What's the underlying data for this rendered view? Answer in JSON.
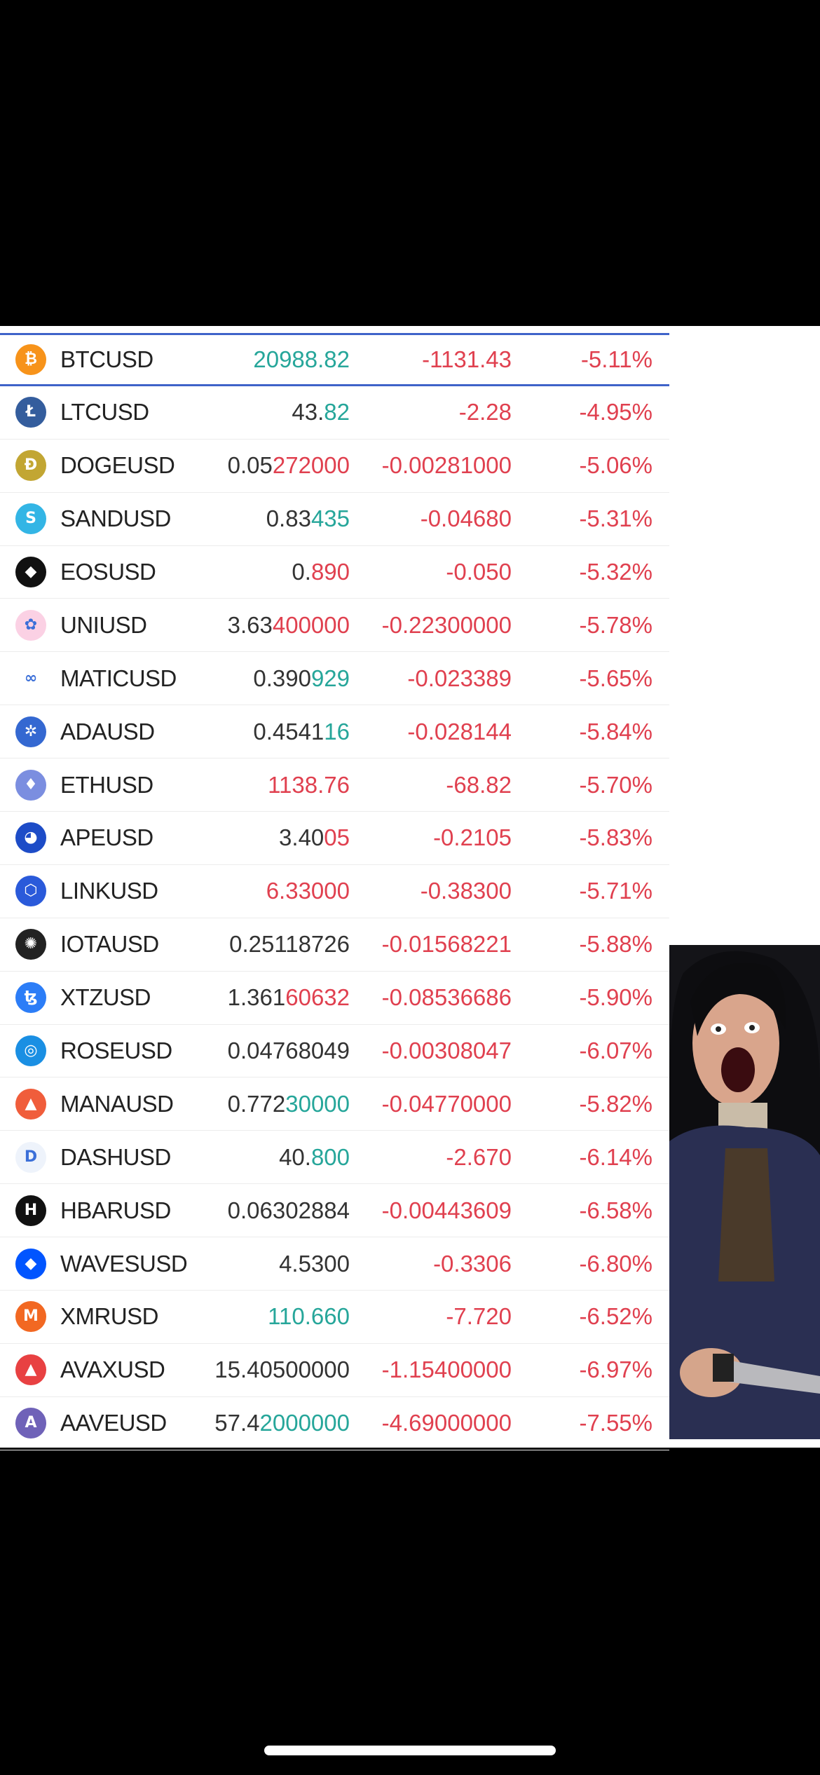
{
  "rows": [
    {
      "symbol": "BTCUSD",
      "icon": "bitcoin-icon",
      "icon_color": "#f7931a",
      "glyph": "₿",
      "last": [
        {
          "t": "20988.82",
          "c": "g"
        }
      ],
      "change": "-1131.43",
      "pct": "-5.11%",
      "selected": true
    },
    {
      "symbol": "LTCUSD",
      "icon": "litecoin-icon",
      "icon_color": "#345d9d",
      "glyph": "Ł",
      "last": [
        {
          "t": "43.",
          "c": ""
        },
        {
          "t": "82",
          "c": "g"
        }
      ],
      "change": "-2.28",
      "pct": "-4.95%"
    },
    {
      "symbol": "DOGEUSD",
      "icon": "dogecoin-icon",
      "icon_color": "#c2a633",
      "glyph": "Ð",
      "last": [
        {
          "t": "0.05",
          "c": ""
        },
        {
          "t": "272000",
          "c": "r"
        }
      ],
      "change": "-0.00281000",
      "pct": "-5.06%"
    },
    {
      "symbol": "SANDUSD",
      "icon": "sandbox-icon",
      "icon_color": "#33b5e5",
      "glyph": "S",
      "last": [
        {
          "t": "0.83",
          "c": ""
        },
        {
          "t": "435",
          "c": "g"
        }
      ],
      "change": "-0.04680",
      "pct": "-5.31%"
    },
    {
      "symbol": "EOSUSD",
      "icon": "eos-icon",
      "icon_color": "#111111",
      "glyph": "◆",
      "last": [
        {
          "t": "0.",
          "c": ""
        },
        {
          "t": "890",
          "c": "r"
        }
      ],
      "change": "-0.050",
      "pct": "-5.32%"
    },
    {
      "symbol": "UNIUSD",
      "icon": "uniswap-icon",
      "icon_color": "#fbd1e4",
      "glyph": "✿",
      "last": [
        {
          "t": "3.63",
          "c": ""
        },
        {
          "t": "400000",
          "c": "r"
        }
      ],
      "change": "-0.22300000",
      "pct": "-5.78%"
    },
    {
      "symbol": "MATICUSD",
      "icon": "polygon-icon",
      "icon_color": "#ffffff",
      "glyph": "∞",
      "last": [
        {
          "t": "0.390",
          "c": ""
        },
        {
          "t": "929",
          "c": "g"
        }
      ],
      "change": "-0.023389",
      "pct": "-5.65%"
    },
    {
      "symbol": "ADAUSD",
      "icon": "cardano-icon",
      "icon_color": "#3468d1",
      "glyph": "✲",
      "last": [
        {
          "t": "0.4541",
          "c": ""
        },
        {
          "t": "16",
          "c": "g"
        }
      ],
      "change": "-0.028144",
      "pct": "-5.84%"
    },
    {
      "symbol": "ETHUSD",
      "icon": "ethereum-icon",
      "icon_color": "#7b8ee0",
      "glyph": "♦",
      "last": [
        {
          "t": "1138.76",
          "c": "r"
        }
      ],
      "change": "-68.82",
      "pct": "-5.70%"
    },
    {
      "symbol": "APEUSD",
      "icon": "apecoin-icon",
      "icon_color": "#1d4cc7",
      "glyph": "◕",
      "last": [
        {
          "t": "3.40",
          "c": ""
        },
        {
          "t": "05",
          "c": "r"
        }
      ],
      "change": "-0.2105",
      "pct": "-5.83%"
    },
    {
      "symbol": "LINKUSD",
      "icon": "chainlink-icon",
      "icon_color": "#2a5ada",
      "glyph": "⬡",
      "last": [
        {
          "t": "6.33000",
          "c": "r"
        }
      ],
      "change": "-0.38300",
      "pct": "-5.71%"
    },
    {
      "symbol": "IOTAUSD",
      "icon": "iota-icon",
      "icon_color": "#222222",
      "glyph": "✺",
      "last": [
        {
          "t": "0.25118726",
          "c": ""
        }
      ],
      "change": "-0.01568221",
      "pct": "-5.88%"
    },
    {
      "symbol": "XTZUSD",
      "icon": "tezos-icon",
      "icon_color": "#2c7df7",
      "glyph": "ꜩ",
      "last": [
        {
          "t": "1.361",
          "c": ""
        },
        {
          "t": "60632",
          "c": "r"
        }
      ],
      "change": "-0.08536686",
      "pct": "-5.90%"
    },
    {
      "symbol": "ROSEUSD",
      "icon": "oasis-icon",
      "icon_color": "#1a8fe3",
      "glyph": "◎",
      "last": [
        {
          "t": "0.04768049",
          "c": ""
        }
      ],
      "change": "-0.00308047",
      "pct": "-6.07%"
    },
    {
      "symbol": "MANAUSD",
      "icon": "decentraland-icon",
      "icon_color": "#f05d3b",
      "glyph": "▲",
      "last": [
        {
          "t": "0.772",
          "c": ""
        },
        {
          "t": "30000",
          "c": "g"
        }
      ],
      "change": "-0.04770000",
      "pct": "-5.82%"
    },
    {
      "symbol": "DASHUSD",
      "icon": "dash-icon",
      "icon_color": "#eef3fb",
      "glyph": "D",
      "last": [
        {
          "t": "40.",
          "c": ""
        },
        {
          "t": "800",
          "c": "g"
        }
      ],
      "change": "-2.670",
      "pct": "-6.14%"
    },
    {
      "symbol": "HBARUSD",
      "icon": "hedera-icon",
      "icon_color": "#111111",
      "glyph": "H",
      "last": [
        {
          "t": "0.06302884",
          "c": ""
        }
      ],
      "change": "-0.00443609",
      "pct": "-6.58%"
    },
    {
      "symbol": "WAVESUSD",
      "icon": "waves-icon",
      "icon_color": "#0155ff",
      "glyph": "◆",
      "last": [
        {
          "t": "4.5300",
          "c": ""
        }
      ],
      "change": "-0.3306",
      "pct": "-6.80%"
    },
    {
      "symbol": "XMRUSD",
      "icon": "monero-icon",
      "icon_color": "#f26822",
      "glyph": "M",
      "last": [
        {
          "t": "110.660",
          "c": "g"
        }
      ],
      "change": "-7.720",
      "pct": "-6.52%"
    },
    {
      "symbol": "AVAXUSD",
      "icon": "avalanche-icon",
      "icon_color": "#e84142",
      "glyph": "▲",
      "last": [
        {
          "t": "15.40500000",
          "c": ""
        }
      ],
      "change": "-1.15400000",
      "pct": "-6.97%"
    },
    {
      "symbol": "AAVEUSD",
      "icon": "aave-icon",
      "icon_color": "#6f62b8",
      "glyph": "A",
      "last": [
        {
          "t": "57.4",
          "c": ""
        },
        {
          "t": "2000000",
          "c": "g"
        }
      ],
      "change": "-4.69000000",
      "pct": "-7.55%"
    }
  ]
}
